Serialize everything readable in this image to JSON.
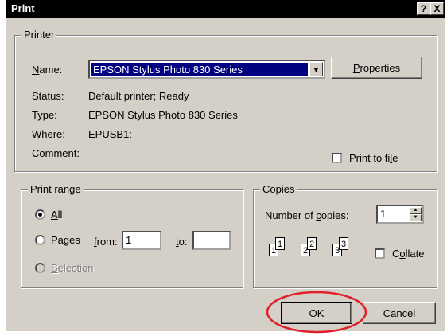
{
  "window": {
    "title": "Print",
    "help_glyph": "?",
    "close_glyph": "X"
  },
  "printer": {
    "group_label": "Printer",
    "name_label_pre": "",
    "name_label_u": "N",
    "name_label_post": "ame:",
    "name_value": "EPSON Stylus Photo 830 Series",
    "properties_pre": "",
    "properties_u": "P",
    "properties_post": "roperties",
    "status_label": "Status:",
    "status_value": "Default printer; Ready",
    "type_label": "Type:",
    "type_value": "EPSON Stylus Photo 830 Series",
    "where_label": "Where:",
    "where_value": "EPUSB1:",
    "comment_label": "Comment:",
    "print_to_file_pre": "Print to fi",
    "print_to_file_u": "l",
    "print_to_file_post": "e"
  },
  "print_range": {
    "group_label": "Print range",
    "all_u": "A",
    "all_post": "ll",
    "pages_label": "Pages",
    "from_u": "f",
    "from_post": "rom:",
    "from_value": "1",
    "to_u": "t",
    "to_post": "o:",
    "to_value": "",
    "selection_u": "S",
    "selection_post": "election"
  },
  "copies": {
    "group_label": "Copies",
    "number_pre": "Number of ",
    "number_u": "c",
    "number_post": "opies:",
    "number_value": "1",
    "collate_pre": "C",
    "collate_u": "o",
    "collate_post": "llate",
    "page_labels": [
      "1",
      "1",
      "2",
      "2",
      "3",
      "3"
    ]
  },
  "buttons": {
    "ok": "OK",
    "cancel": "Cancel"
  },
  "colors": {
    "highlight_circle": "#e0202a",
    "selection": "#000080",
    "face": "#d4d0c8"
  }
}
